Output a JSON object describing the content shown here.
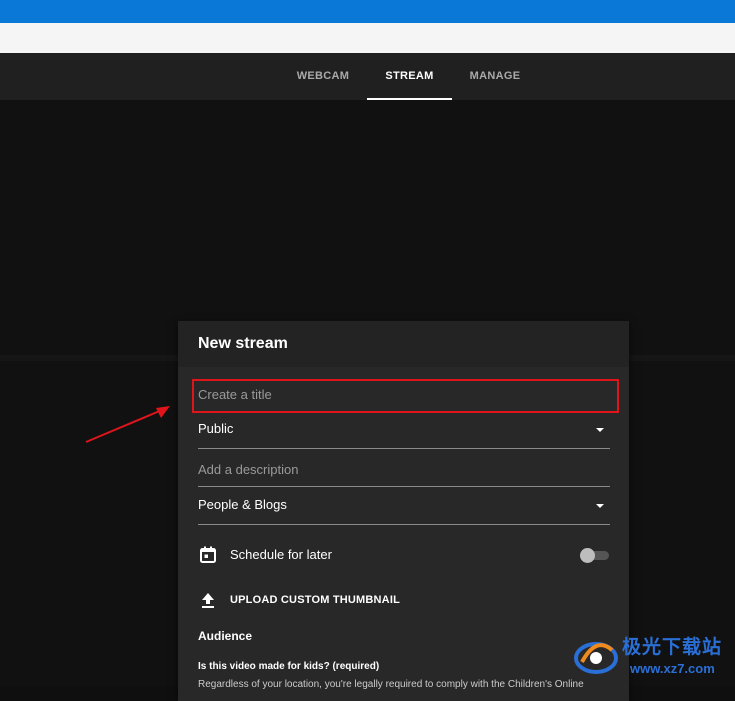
{
  "nav": {
    "tabs": [
      {
        "label": "WEBCAM"
      },
      {
        "label": "STREAM"
      },
      {
        "label": "MANAGE"
      }
    ],
    "active_tab": "STREAM"
  },
  "dialog": {
    "title": "New stream",
    "title_input": {
      "placeholder": "Create a title",
      "value": ""
    },
    "visibility": {
      "value": "Public"
    },
    "description_input": {
      "placeholder": "Add a description",
      "value": ""
    },
    "category": {
      "value": "People & Blogs"
    },
    "schedule": {
      "label": "Schedule for later",
      "enabled": false
    },
    "thumbnail": {
      "label": "UPLOAD CUSTOM THUMBNAIL"
    },
    "audience": {
      "title": "Audience",
      "question": "Is this video made for kids? (required)",
      "body_partial": "Regardless of your location, you're legally required to comply with the Children's Online"
    }
  },
  "watermark": {
    "line1": "极光下载站",
    "line2": "www.xz7.com"
  },
  "colors": {
    "os_titlebar": "#0a78d7",
    "highlight_box": "#e0151b",
    "annotation_arrow": "#e0151b",
    "watermark": "#2a6fd6"
  },
  "icons": [
    "calendar-icon",
    "upload-icon",
    "dropdown-caret-icon",
    "annotation-arrow"
  ]
}
